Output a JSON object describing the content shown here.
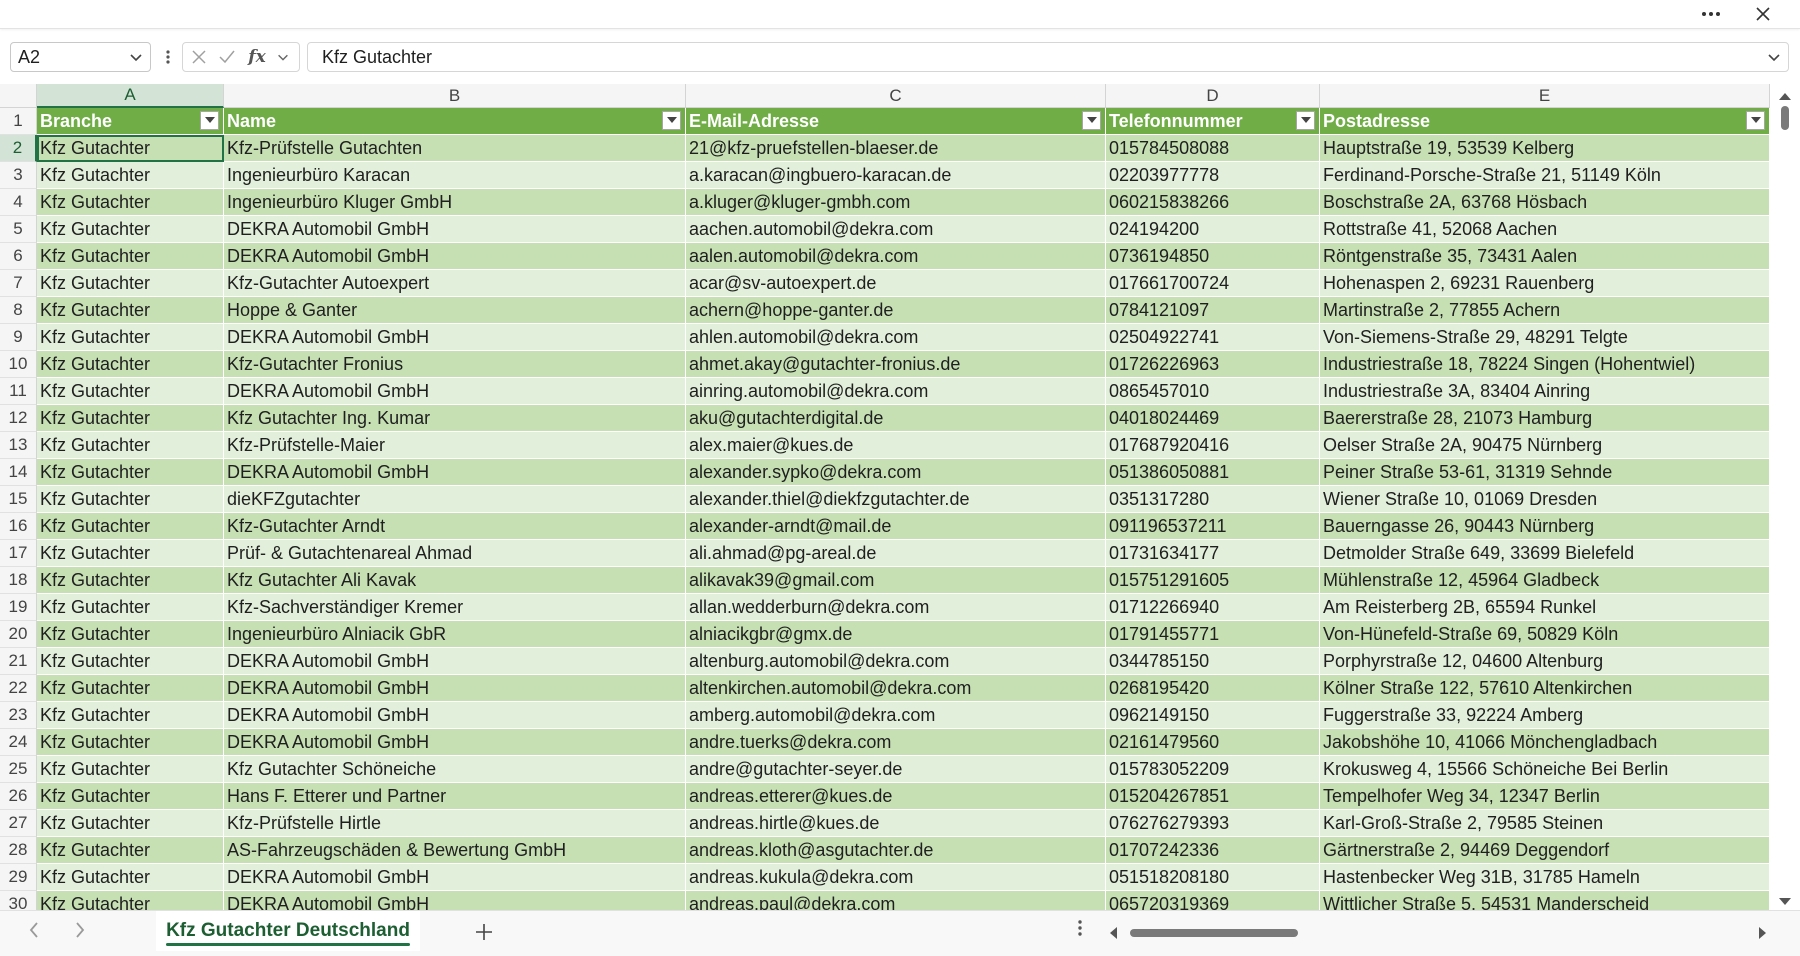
{
  "titlebar": {
    "more_icon": "more-horizontal-icon",
    "close_icon": "close-icon"
  },
  "formula_bar": {
    "name_box": "A2",
    "formula_value": "Kfz Gutachter",
    "cancel_icon": "cancel-x-icon",
    "enter_icon": "checkmark-icon",
    "fx_label": "fx"
  },
  "columns": [
    "A",
    "B",
    "C",
    "D",
    "E"
  ],
  "header_row": [
    "Branche",
    "Name",
    "E-Mail-Adresse",
    "Telefonnummer",
    "Postadresse"
  ],
  "rows": [
    {
      "n": "2",
      "cells": [
        "Kfz Gutachter",
        "Kfz-Prüfstelle Gutachten",
        "21@kfz-pruefstellen-blaeser.de",
        "015784508088",
        "Hauptstraße 19, 53539 Kelberg"
      ]
    },
    {
      "n": "3",
      "cells": [
        "Kfz Gutachter",
        "Ingenieurbüro Karacan",
        "a.karacan@ingbuero-karacan.de",
        "02203977778",
        "Ferdinand-Porsche-Straße 21, 51149 Köln"
      ]
    },
    {
      "n": "4",
      "cells": [
        "Kfz Gutachter",
        "Ingenieurbüro Kluger GmbH",
        "a.kluger@kluger-gmbh.com",
        "060215838266",
        "Boschstraße 2A, 63768 Hösbach"
      ]
    },
    {
      "n": "5",
      "cells": [
        "Kfz Gutachter",
        "DEKRA Automobil GmbH",
        "aachen.automobil@dekra.com",
        "024194200",
        "Rottstraße 41, 52068 Aachen"
      ]
    },
    {
      "n": "6",
      "cells": [
        "Kfz Gutachter",
        "DEKRA Automobil GmbH",
        "aalen.automobil@dekra.com",
        "0736194850",
        "Röntgenstraße 35, 73431 Aalen"
      ]
    },
    {
      "n": "7",
      "cells": [
        "Kfz Gutachter",
        "Kfz-Gutachter Autoexpert",
        "acar@sv-autoexpert.de",
        "017661700724",
        "Hohenaspen 2, 69231 Rauenberg"
      ]
    },
    {
      "n": "8",
      "cells": [
        "Kfz Gutachter",
        "Hoppe & Ganter",
        "achern@hoppe-ganter.de",
        "0784121097",
        "Martinstraße 2, 77855 Achern"
      ]
    },
    {
      "n": "9",
      "cells": [
        "Kfz Gutachter",
        "DEKRA Automobil GmbH",
        "ahlen.automobil@dekra.com",
        "02504922741",
        "Von-Siemens-Straße 29, 48291 Telgte"
      ]
    },
    {
      "n": "10",
      "cells": [
        "Kfz Gutachter",
        "Kfz-Gutachter Fronius",
        "ahmet.akay@gutachter-fronius.de",
        "01726226963",
        "Industriestraße 18, 78224 Singen (Hohentwiel)"
      ]
    },
    {
      "n": "11",
      "cells": [
        "Kfz Gutachter",
        "DEKRA Automobil GmbH",
        "ainring.automobil@dekra.com",
        "0865457010",
        "Industriestraße 3A, 83404 Ainring"
      ]
    },
    {
      "n": "12",
      "cells": [
        "Kfz Gutachter",
        "Kfz Gutachter Ing. Kumar",
        "aku@gutachterdigital.de",
        "04018024469",
        "Baererstraße 28, 21073 Hamburg"
      ]
    },
    {
      "n": "13",
      "cells": [
        "Kfz Gutachter",
        "Kfz-Prüfstelle-Maier",
        "alex.maier@kues.de",
        "017687920416",
        "Oelser Straße 2A, 90475 Nürnberg"
      ]
    },
    {
      "n": "14",
      "cells": [
        "Kfz Gutachter",
        "DEKRA Automobil GmbH",
        "alexander.sypko@dekra.com",
        "051386050881",
        "Peiner Straße 53-61, 31319 Sehnde"
      ]
    },
    {
      "n": "15",
      "cells": [
        "Kfz Gutachter",
        "dieKFZgutachter",
        "alexander.thiel@diekfzgutachter.de",
        "0351317280",
        "Wiener Straße 10, 01069 Dresden"
      ]
    },
    {
      "n": "16",
      "cells": [
        "Kfz Gutachter",
        "Kfz-Gutachter Arndt",
        "alexander-arndt@mail.de",
        "091196537211",
        "Bauerngasse 26, 90443 Nürnberg"
      ]
    },
    {
      "n": "17",
      "cells": [
        "Kfz Gutachter",
        "Prüf- & Gutachtenareal Ahmad",
        "ali.ahmad@pg-areal.de",
        "01731634177",
        "Detmolder Straße 649, 33699 Bielefeld"
      ]
    },
    {
      "n": "18",
      "cells": [
        "Kfz Gutachter",
        "Kfz Gutachter Ali Kavak",
        "alikavak39@gmail.com",
        "015751291605",
        "Mühlenstraße 12, 45964 Gladbeck"
      ]
    },
    {
      "n": "19",
      "cells": [
        "Kfz Gutachter",
        "Kfz-Sachverständiger Kremer",
        "allan.wedderburn@dekra.com",
        "01712266940",
        "Am Reisterberg 2B, 65594 Runkel"
      ]
    },
    {
      "n": "20",
      "cells": [
        "Kfz Gutachter",
        "Ingenieurbüro Alniacik GbR",
        "alniacikgbr@gmx.de",
        "01791455771",
        "Von-Hünefeld-Straße 69, 50829 Köln"
      ]
    },
    {
      "n": "21",
      "cells": [
        "Kfz Gutachter",
        "DEKRA Automobil GmbH",
        "altenburg.automobil@dekra.com",
        "0344785150",
        "Porphyrstraße 12, 04600 Altenburg"
      ]
    },
    {
      "n": "22",
      "cells": [
        "Kfz Gutachter",
        "DEKRA Automobil GmbH",
        "altenkirchen.automobil@dekra.com",
        "0268195420",
        "Kölner Straße 122, 57610 Altenkirchen"
      ]
    },
    {
      "n": "23",
      "cells": [
        "Kfz Gutachter",
        "DEKRA Automobil GmbH",
        "amberg.automobil@dekra.com",
        "0962149150",
        "Fuggerstraße 33, 92224 Amberg"
      ]
    },
    {
      "n": "24",
      "cells": [
        "Kfz Gutachter",
        "DEKRA Automobil GmbH",
        "andre.tuerks@dekra.com",
        "02161479560",
        "Jakobshöhe 10, 41066 Mönchengladbach"
      ]
    },
    {
      "n": "25",
      "cells": [
        "Kfz Gutachter",
        "Kfz Gutachter Schöneiche",
        "andre@gutachter-seyer.de",
        "015783052209",
        "Krokusweg 4, 15566 Schöneiche Bei Berlin"
      ]
    },
    {
      "n": "26",
      "cells": [
        "Kfz Gutachter",
        "Hans F. Etterer und Partner",
        "andreas.etterer@kues.de",
        "015204267851",
        "Tempelhofer Weg 34, 12347 Berlin"
      ]
    },
    {
      "n": "27",
      "cells": [
        "Kfz Gutachter",
        "Kfz-Prüfstelle Hirtle",
        "andreas.hirtle@kues.de",
        "076276279393",
        "Karl-Groß-Straße 2, 79585 Steinen"
      ]
    },
    {
      "n": "28",
      "cells": [
        "Kfz Gutachter",
        "AS-Fahrzeugschäden & Bewertung GmbH",
        "andreas.kloth@asgutachter.de",
        "01707242336",
        "Gärtnerstraße 2, 94469 Deggendorf"
      ]
    },
    {
      "n": "29",
      "cells": [
        "Kfz Gutachter",
        "DEKRA Automobil GmbH",
        "andreas.kukula@dekra.com",
        "051518208180",
        "Hastenbecker Weg 31B, 31785 Hameln"
      ]
    },
    {
      "n": "30",
      "cells": [
        "Kfz Gutachter",
        "DEKRA Automobil GmbH",
        "andreas.paul@dekra.com",
        "065720319369",
        "Wittlicher Straße 5, 54531 Manderscheid"
      ]
    }
  ],
  "sheet_tabs": [
    {
      "label": "Kfz Gutachter Deutschland",
      "active": true
    }
  ],
  "colors": {
    "header_green": "#70ad47",
    "band_dark": "#c6e0b4",
    "band_light": "#e2efda",
    "accent": "#217346"
  }
}
